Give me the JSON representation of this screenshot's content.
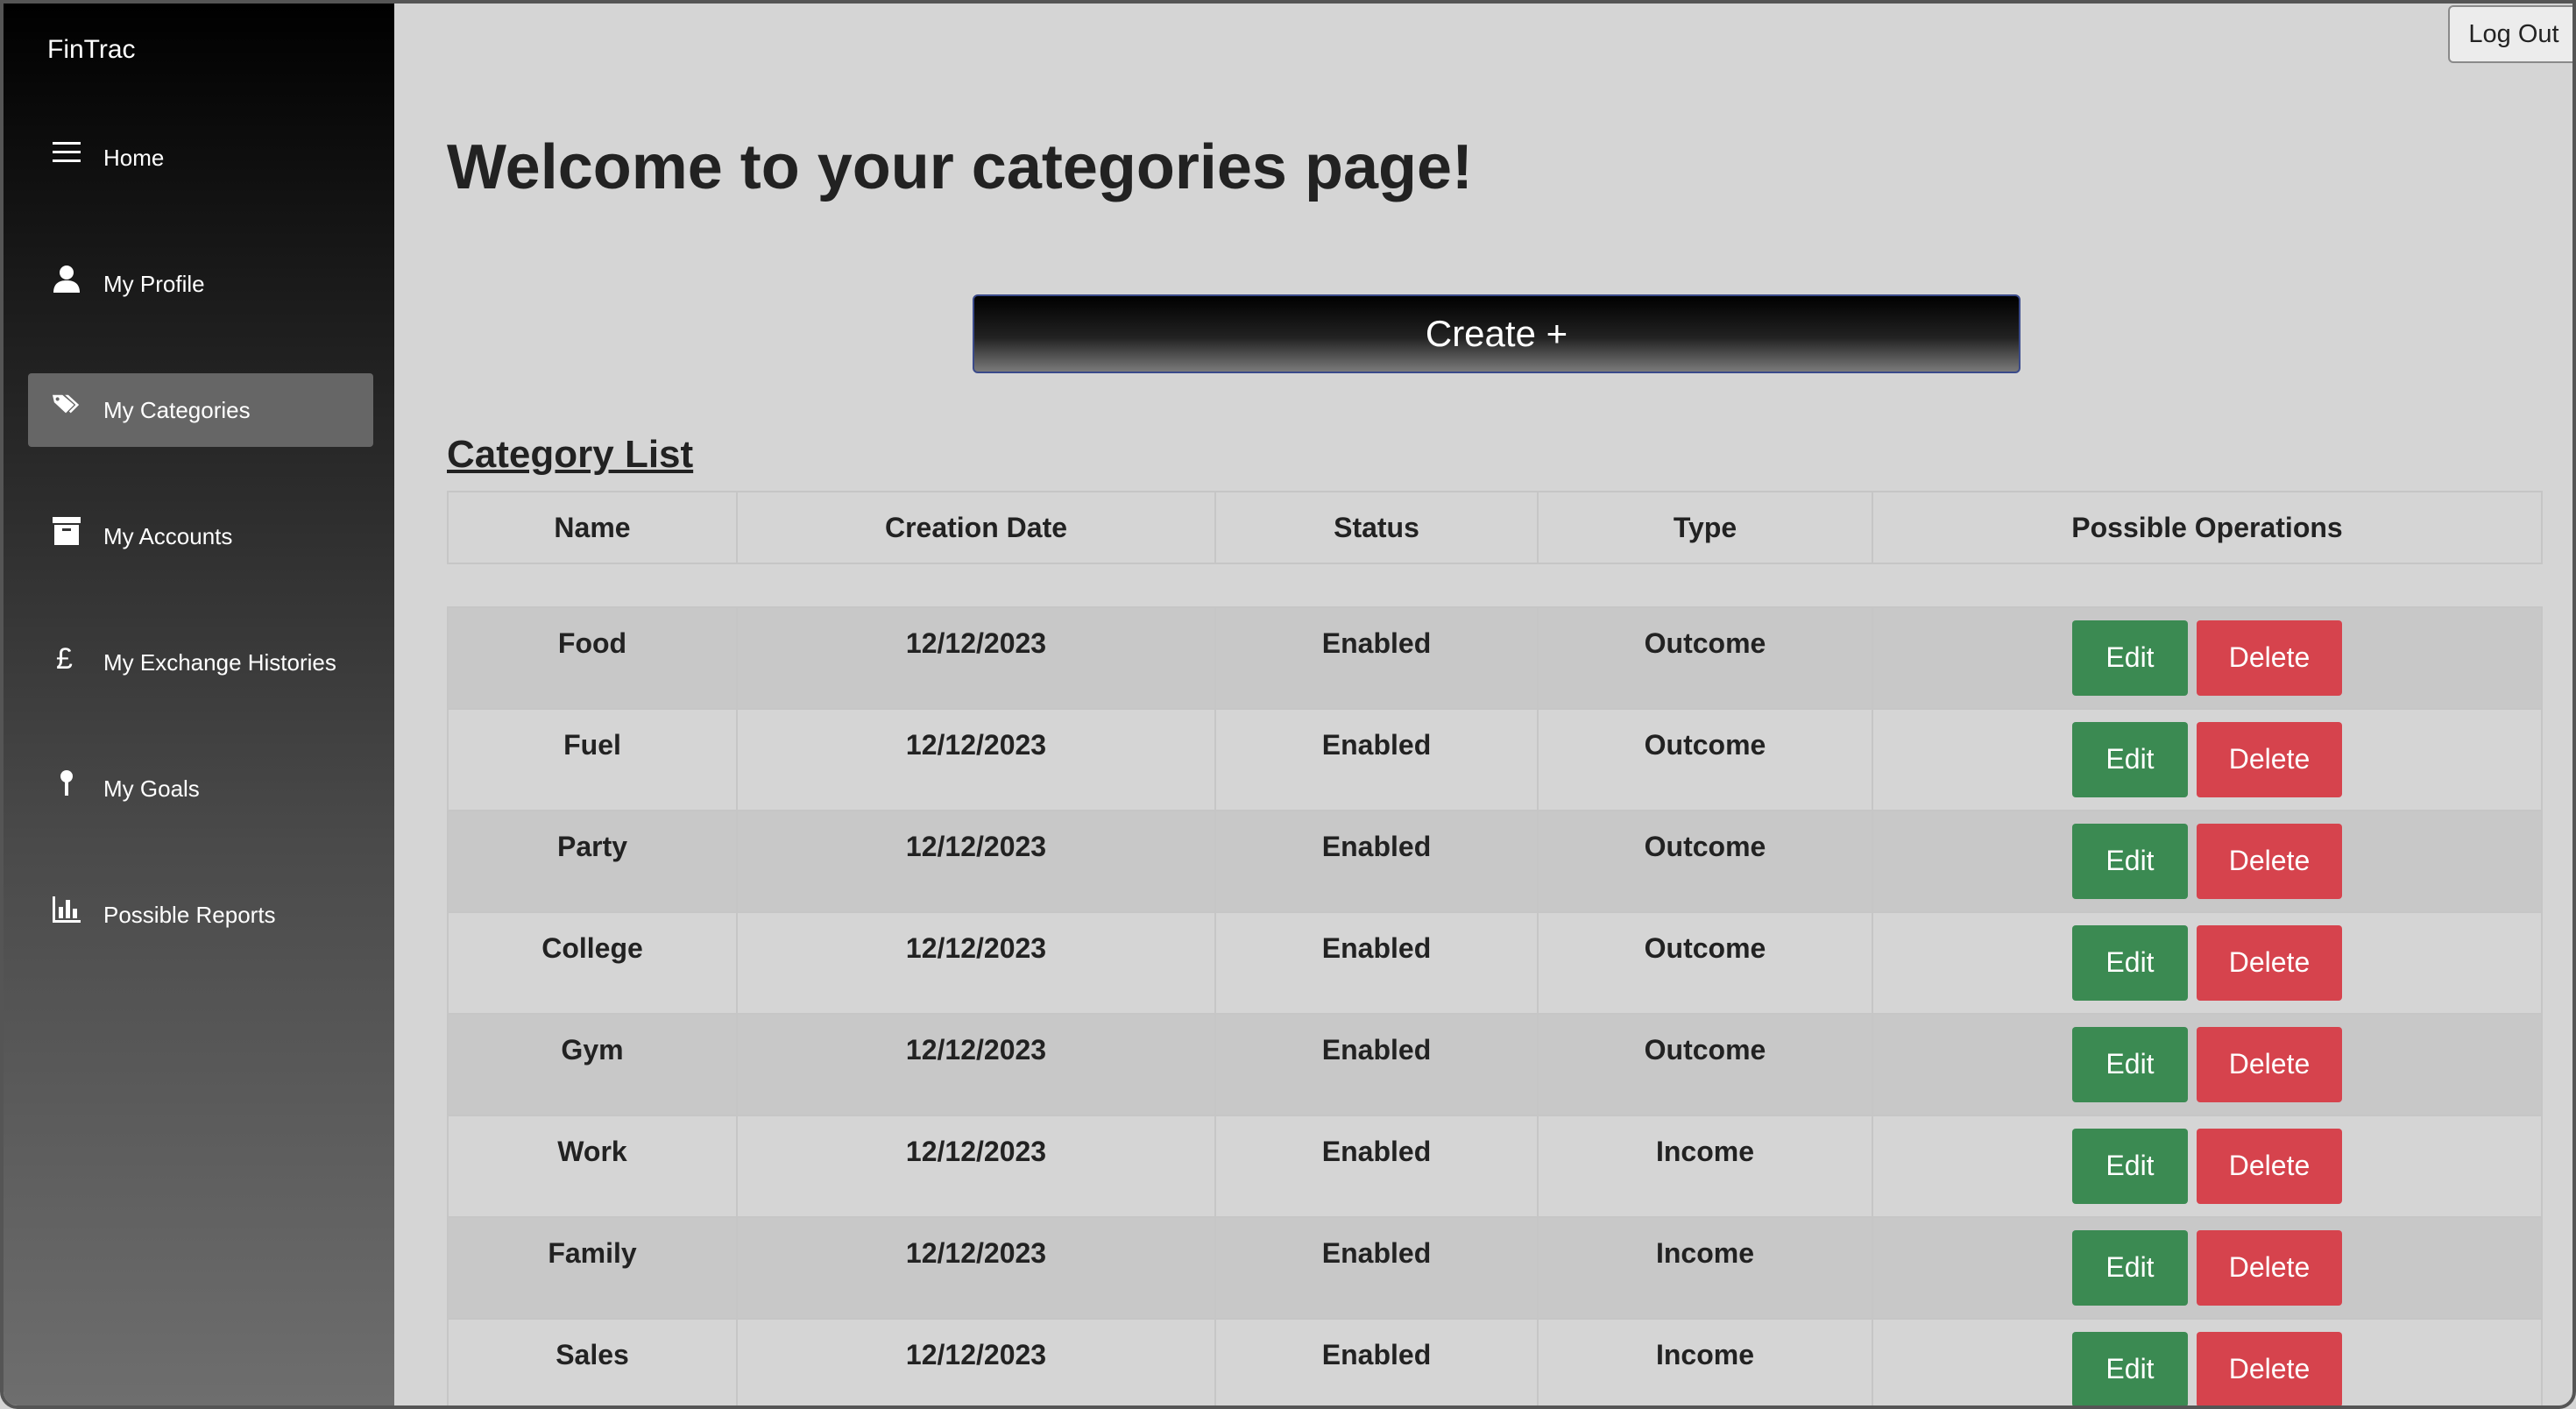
{
  "sidebar": {
    "brand": "FinTrac",
    "items": [
      {
        "label": "Home",
        "icon": "menu-icon",
        "active": false
      },
      {
        "label": "My Profile",
        "icon": "user-icon",
        "active": false
      },
      {
        "label": "My Categories",
        "icon": "tags-icon",
        "active": true
      },
      {
        "label": "My Accounts",
        "icon": "archive-icon",
        "active": false
      },
      {
        "label": "My Exchange Histories",
        "icon": "pound-icon",
        "active": false
      },
      {
        "label": "My Goals",
        "icon": "pin-icon",
        "active": false
      },
      {
        "label": "Possible Reports",
        "icon": "bar-chart-icon",
        "active": false
      }
    ]
  },
  "header": {
    "logout_label": "Log Out"
  },
  "main": {
    "title": "Welcome to your categories page!",
    "create_label": "Create +",
    "section_title": "Category List"
  },
  "table": {
    "columns": [
      "Name",
      "Creation Date",
      "Status",
      "Type",
      "Possible Operations"
    ],
    "edit_label": "Edit",
    "delete_label": "Delete",
    "rows": [
      {
        "name": "Food",
        "date": "12/12/2023",
        "status": "Enabled",
        "type": "Outcome"
      },
      {
        "name": "Fuel",
        "date": "12/12/2023",
        "status": "Enabled",
        "type": "Outcome"
      },
      {
        "name": "Party",
        "date": "12/12/2023",
        "status": "Enabled",
        "type": "Outcome"
      },
      {
        "name": "College",
        "date": "12/12/2023",
        "status": "Enabled",
        "type": "Outcome"
      },
      {
        "name": "Gym",
        "date": "12/12/2023",
        "status": "Enabled",
        "type": "Outcome"
      },
      {
        "name": "Work",
        "date": "12/12/2023",
        "status": "Enabled",
        "type": "Income"
      },
      {
        "name": "Family",
        "date": "12/12/2023",
        "status": "Enabled",
        "type": "Income"
      },
      {
        "name": "Sales",
        "date": "12/12/2023",
        "status": "Enabled",
        "type": "Income"
      }
    ]
  },
  "colors": {
    "edit": "#3b8a52",
    "delete": "#d6434d",
    "active_nav": "#666666"
  }
}
